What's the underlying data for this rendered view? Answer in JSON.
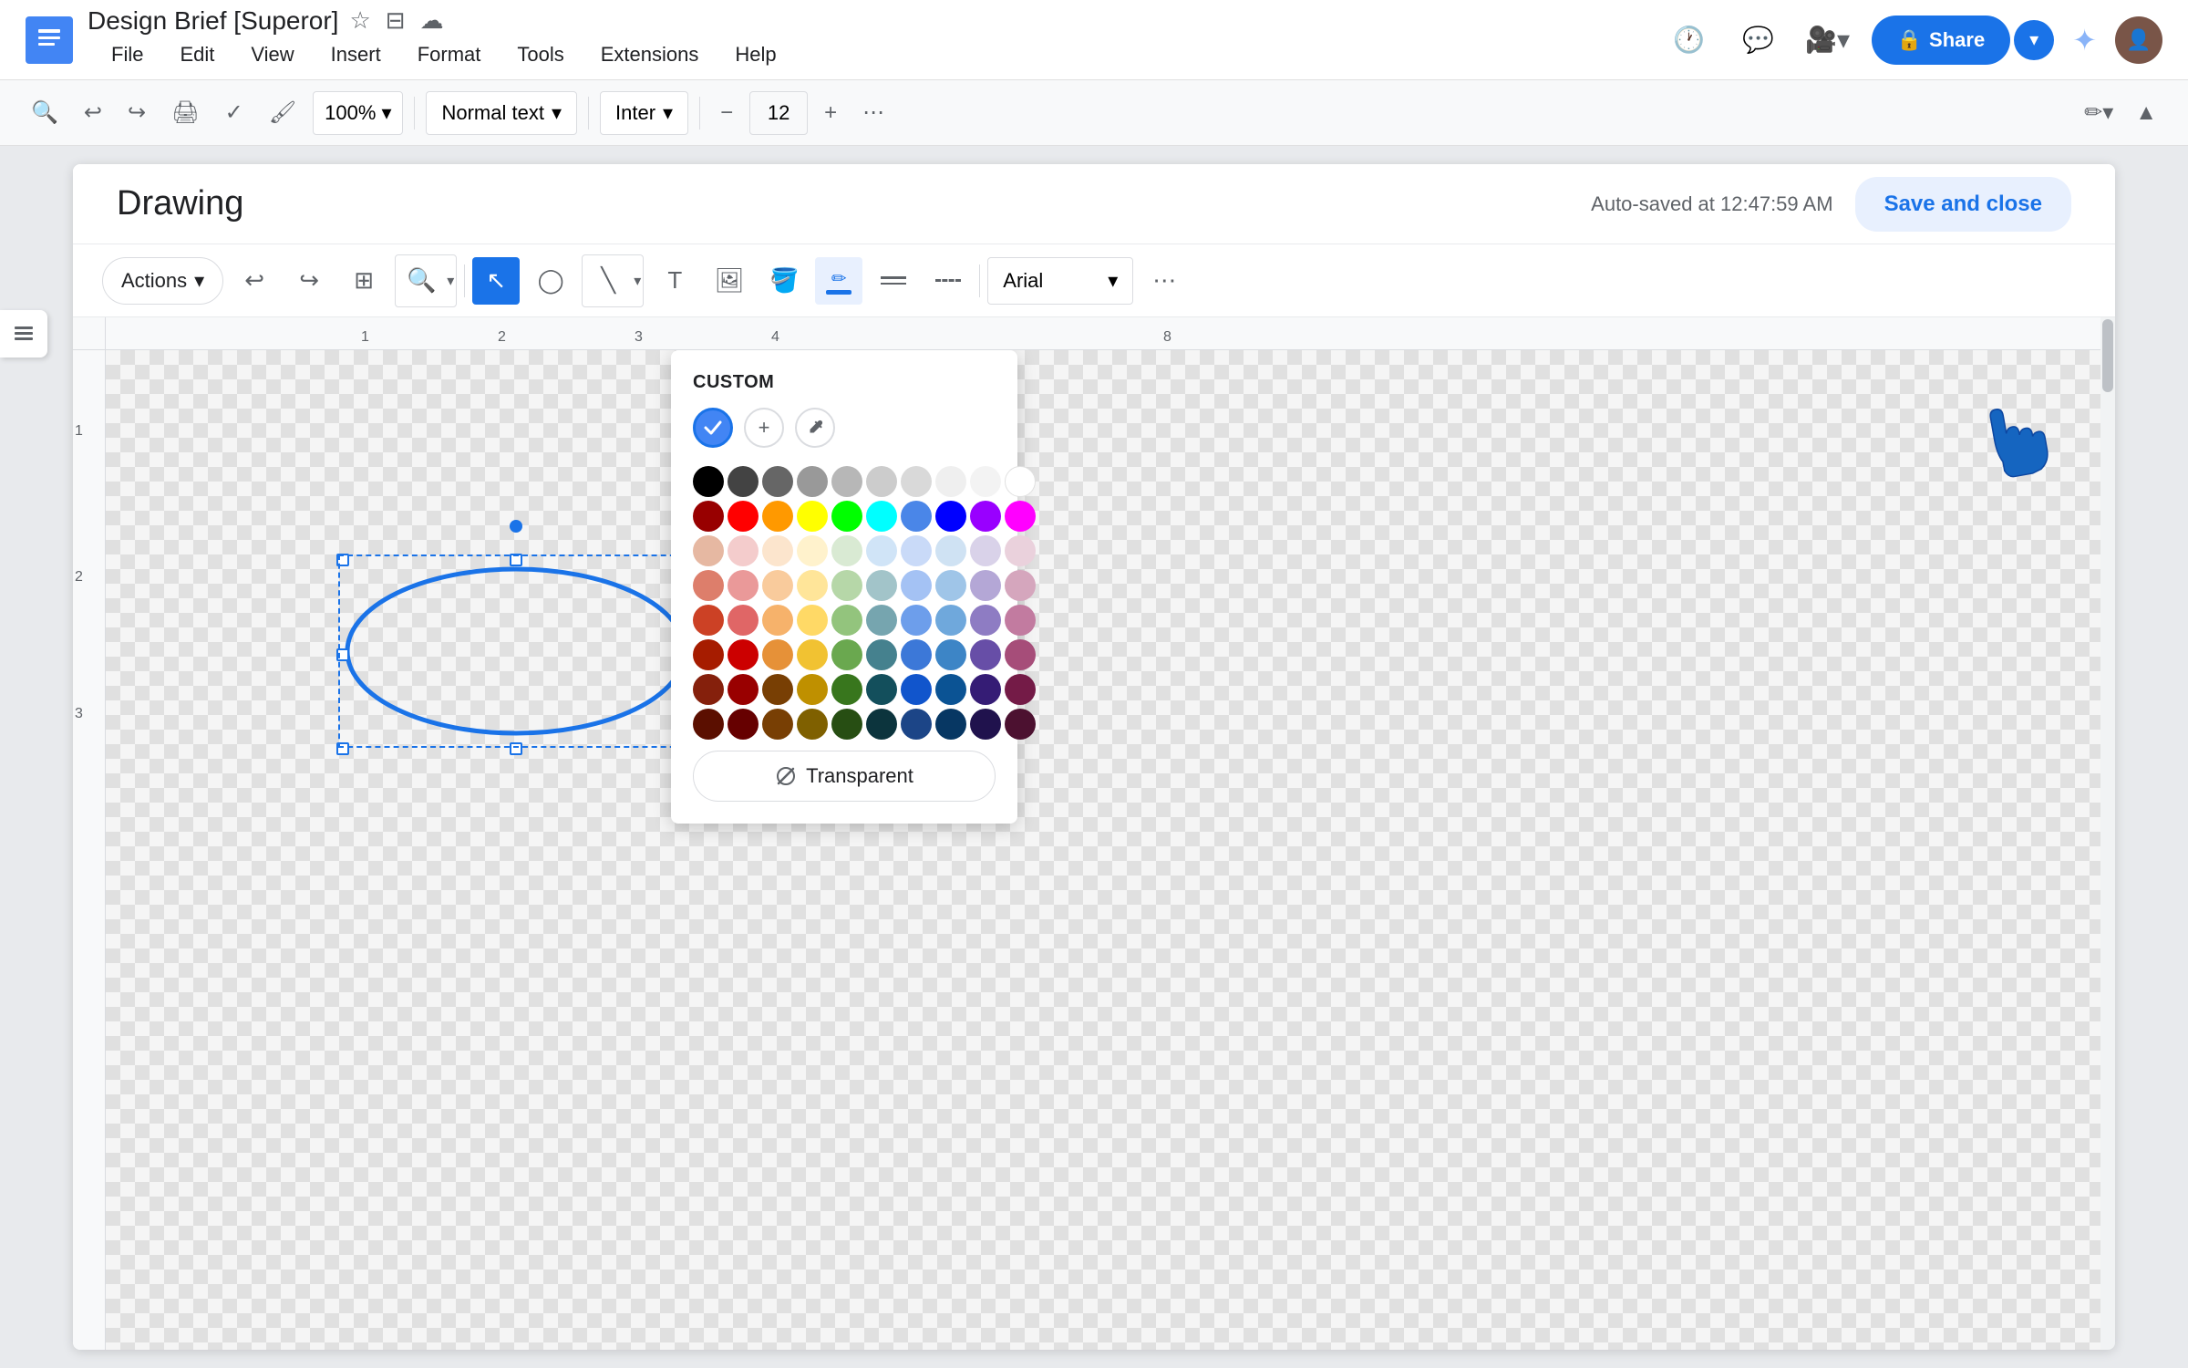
{
  "app": {
    "icon": "≡",
    "doc_title": "Design Brief [Superor]",
    "title_star_icon": "☆",
    "title_folder_icon": "⊟",
    "title_cloud_icon": "☁"
  },
  "menu": {
    "items": [
      "File",
      "Edit",
      "View",
      "Insert",
      "Format",
      "Tools",
      "Extensions",
      "Help"
    ]
  },
  "top_toolbar": {
    "zoom_label": "100%",
    "style_label": "Normal text",
    "font_label": "Inter",
    "font_size": "12",
    "share_label": "Share",
    "share_lock_icon": "🔒"
  },
  "drawing": {
    "title": "Drawing",
    "autosave": "Auto-saved at 12:47:59 AM",
    "save_close": "Save and close"
  },
  "drawing_toolbar": {
    "actions_label": "Actions",
    "font_label": "Arial"
  },
  "color_picker": {
    "section_title": "CUSTOM",
    "transparent_label": "Transparent",
    "rows": [
      [
        "#000000",
        "#434343",
        "#666666",
        "#999999",
        "#b7b7b7",
        "#cccccc",
        "#d9d9d9",
        "#efefef",
        "#f3f3f3",
        "#ffffff"
      ],
      [
        "#980000",
        "#ff0000",
        "#ff9900",
        "#ffff00",
        "#00ff00",
        "#00ffff",
        "#4a86e8",
        "#0000ff",
        "#9900ff",
        "#ff00ff"
      ],
      [
        "#e6b8a2",
        "#f4cccc",
        "#fce5cd",
        "#fff2cc",
        "#d9ead3",
        "#d0e4f7",
        "#c9daf8",
        "#cfe2f3",
        "#d9d2e9",
        "#ead1dc"
      ],
      [
        "#dd7e6b",
        "#ea9999",
        "#f9cb9c",
        "#ffe599",
        "#b6d7a8",
        "#a2c4c9",
        "#a4c2f4",
        "#9fc5e8",
        "#b4a7d6",
        "#d5a6bd"
      ],
      [
        "#cc4125",
        "#e06666",
        "#f6b26b",
        "#ffd966",
        "#93c47d",
        "#76a5af",
        "#6d9eeb",
        "#6fa8dc",
        "#8e7cc3",
        "#c27ba0"
      ],
      [
        "#a61c00",
        "#cc0000",
        "#e69138",
        "#f1c232",
        "#6aa84f",
        "#45818e",
        "#3c78d8",
        "#3d85c6",
        "#674ea7",
        "#a64d79"
      ],
      [
        "#85200c",
        "#990000",
        "#b45f06",
        "#bf9000",
        "#38761d",
        "#134f5c",
        "#1155cc",
        "#0b5394",
        "#351c75",
        "#741b47"
      ],
      [
        "#5b0f00",
        "#660000",
        "#783f04",
        "#7f6000",
        "#274e13",
        "#0c343d",
        "#1c4587",
        "#073763",
        "#20124d",
        "#4c1130"
      ]
    ]
  },
  "ruler": {
    "h_marks": [
      "1",
      "2",
      "3",
      "4",
      "8"
    ],
    "v_marks": [
      "1",
      "2",
      "3"
    ]
  }
}
